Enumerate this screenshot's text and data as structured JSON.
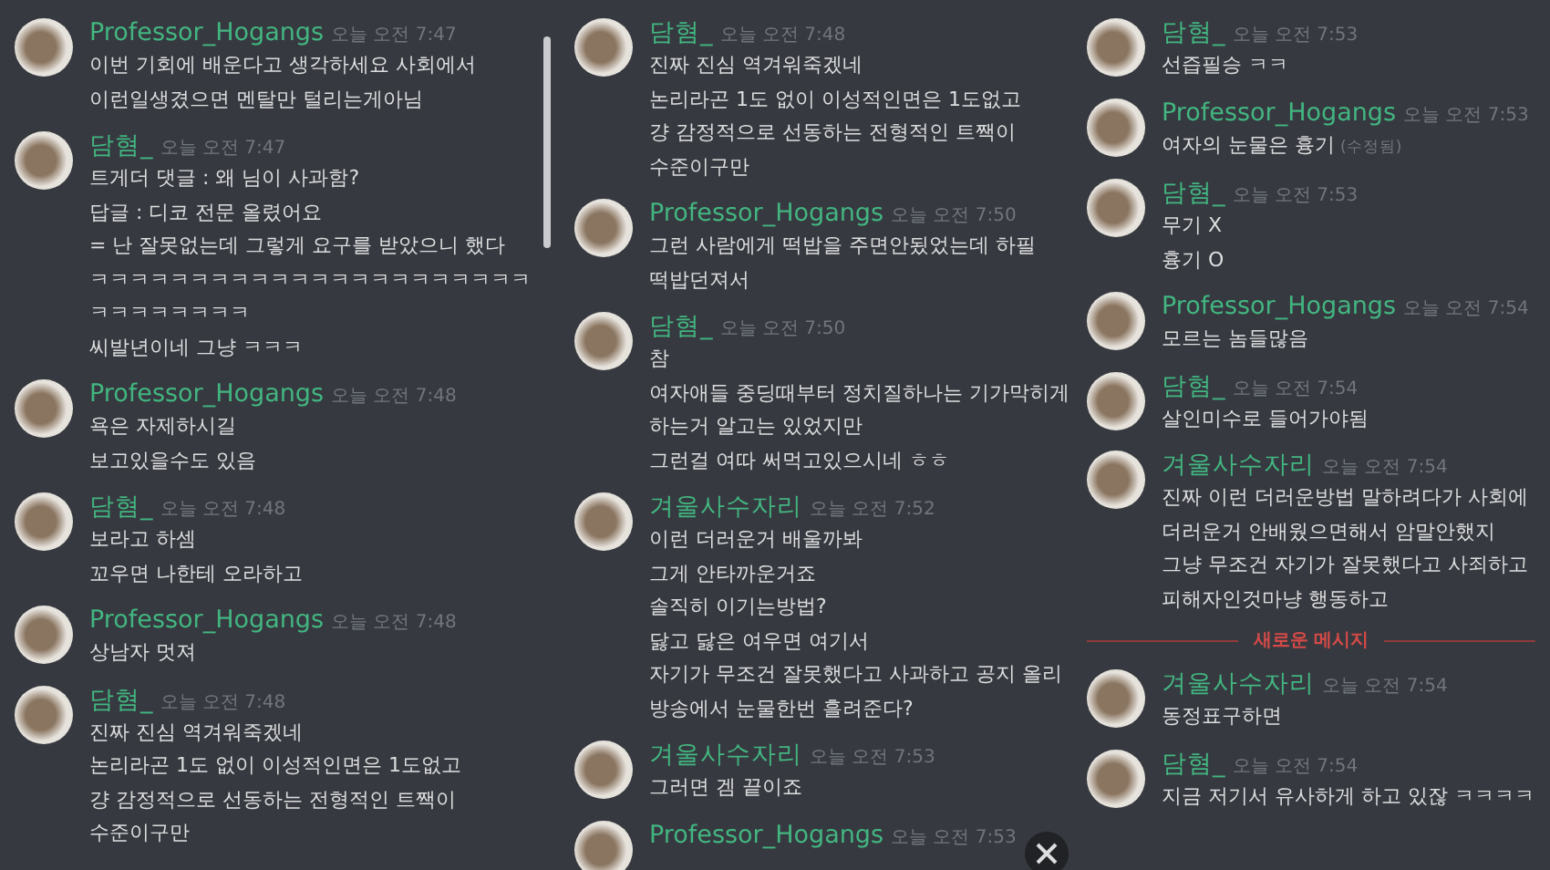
{
  "panels": [
    {
      "messages": [
        {
          "kind": "message",
          "author": "Professor_Hogangs",
          "time": "오늘 오전 7:47",
          "lines": [
            "이번 기회에 배운다고 생각하세요 사회에서",
            "이런일생겼으면 멘탈만 털리는게아님"
          ]
        },
        {
          "kind": "message",
          "author": "담혐_",
          "time": "오늘 오전 7:47",
          "lines": [
            "트게더 댓글 : 왜 님이 사과함?",
            "답글 : 디코 전문 올렸어요",
            "= 난 잘못없는데 그렇게 요구를 받았으니 했다",
            "ㅋㅋㅋㅋㅋㅋㅋㅋㅋㅋㅋㅋㅋㅋㅋㅋㅋㅋㅋㅋㅋㅋ",
            "ㅋㅋㅋㅋㅋㅋㅋㅋ",
            "씨발년이네 그냥 ㅋㅋㅋ"
          ]
        },
        {
          "kind": "message",
          "author": "Professor_Hogangs",
          "time": "오늘 오전 7:48",
          "lines": [
            "욕은 자제하시길",
            "보고있을수도 있음"
          ]
        },
        {
          "kind": "message",
          "author": "담혐_",
          "time": "오늘 오전 7:48",
          "lines": [
            "보라고 하셈",
            "꼬우면 나한테 오라하고"
          ]
        },
        {
          "kind": "message",
          "author": "Professor_Hogangs",
          "time": "오늘 오전 7:48",
          "lines": [
            "상남자 멋져"
          ]
        },
        {
          "kind": "message",
          "author": "담혐_",
          "time": "오늘 오전 7:48",
          "lines": [
            "진짜 진심 역겨워죽겠네",
            "논리라곤 1도 없이 이성적인면은 1도없고",
            "걍 감정적으로 선동하는 전형적인 트짹이",
            "수준이구만"
          ]
        }
      ]
    },
    {
      "messages": [
        {
          "kind": "message",
          "author": "담혐_",
          "time": "오늘 오전 7:48",
          "lines": [
            "진짜 진심 역겨워죽겠네",
            "논리라곤 1도 없이 이성적인면은 1도없고",
            "걍 감정적으로 선동하는 전형적인 트짹이",
            "수준이구만"
          ]
        },
        {
          "kind": "message",
          "author": "Professor_Hogangs",
          "time": "오늘 오전 7:50",
          "lines": [
            "그런 사람에게 떡밥을 주면안됬었는데 하필",
            "떡밥던져서"
          ]
        },
        {
          "kind": "message",
          "author": "담혐_",
          "time": "오늘 오전 7:50",
          "lines": [
            "참",
            "여자애들 중딩때부터 정치질하나는 기가막히게",
            "하는거 알고는 있었지만",
            "그런걸 여따 써먹고있으시네 ㅎㅎ"
          ]
        },
        {
          "kind": "message",
          "author": "겨울사수자리",
          "time": "오늘 오전 7:52",
          "lines": [
            "이런 더러운거 배울까봐",
            "그게 안타까운거죠",
            "솔직히 이기는방법?",
            "닳고 닳은 여우면 여기서",
            "자기가 무조건 잘못했다고 사과하고 공지 올리",
            "방송에서 눈물한번 흘려준다?"
          ]
        },
        {
          "kind": "message",
          "author": "겨울사수자리",
          "time": "오늘 오전 7:53",
          "lines": [
            "그러면 겜 끝이죠"
          ]
        },
        {
          "kind": "message",
          "author": "Professor_Hogangs",
          "time": "오늘 오전 7:53"
        }
      ]
    },
    {
      "messages": [
        {
          "kind": "message",
          "author": "담혐_",
          "time": "오늘 오전 7:53",
          "lines": [
            "선즙필승 ㅋㅋ"
          ]
        },
        {
          "kind": "message",
          "author": "Professor_Hogangs",
          "time": "오늘 오전 7:53",
          "lines": [
            "여자의 눈물은 흉기"
          ],
          "edited": "(수정됨)"
        },
        {
          "kind": "message",
          "author": "담혐_",
          "time": "오늘 오전 7:53",
          "lines": [
            "무기 X",
            "흉기 O"
          ]
        },
        {
          "kind": "message",
          "author": "Professor_Hogangs",
          "time": "오늘 오전 7:54",
          "lines": [
            "모르는 놈들많음"
          ]
        },
        {
          "kind": "message",
          "author": "담혐_",
          "time": "오늘 오전 7:54",
          "lines": [
            "살인미수로 들어가야됨"
          ]
        },
        {
          "kind": "message",
          "author": "겨울사수자리",
          "time": "오늘 오전 7:54",
          "lines": [
            "진짜 이런 더러운방법 말하려다가 사회에",
            "더러운거 안배웠으면해서 암말안했지",
            "그냥 무조건 자기가 잘못했다고 사죄하고",
            "피해자인것마냥 행동하고"
          ]
        },
        {
          "kind": "divider",
          "label": "새로운 메시지"
        },
        {
          "kind": "message",
          "author": "겨울사수자리",
          "time": "오늘 오전 7:54",
          "lines": [
            "동정표구하면"
          ]
        },
        {
          "kind": "message",
          "author": "담혐_",
          "time": "오늘 오전 7:54",
          "lines": [
            "지금 저기서 유사하게 하고 있잖 ㅋㅋㅋㅋ"
          ]
        }
      ]
    }
  ]
}
